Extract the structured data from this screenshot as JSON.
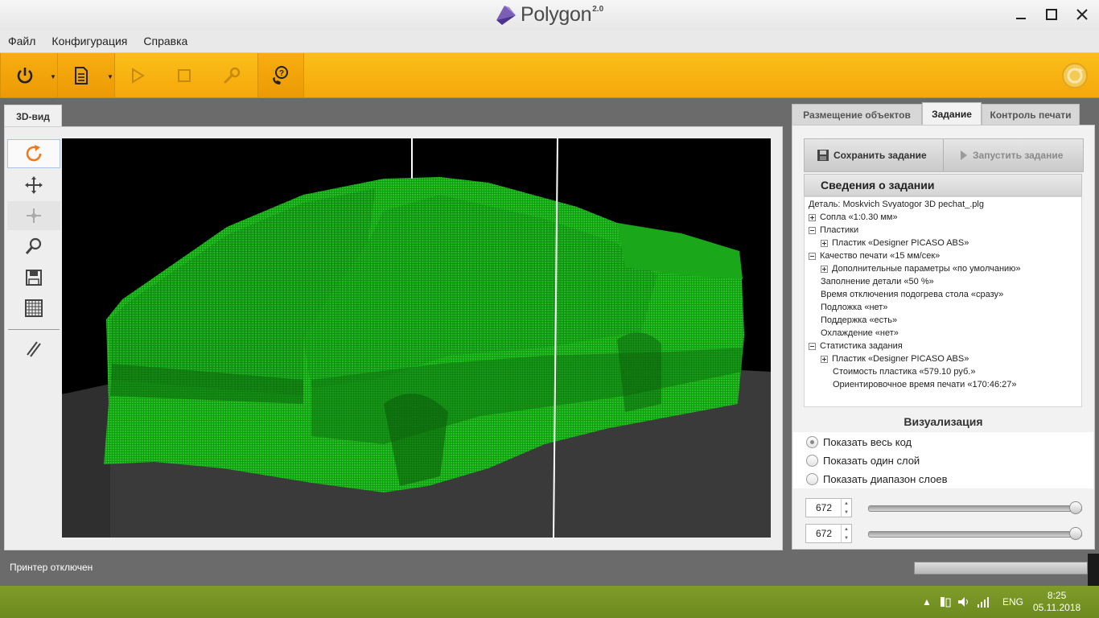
{
  "app": {
    "name": "Polygon",
    "version": "2.0"
  },
  "menu": [
    "Файл",
    "Конфигурация",
    "Справка"
  ],
  "left": {
    "tab_label": "3D-вид"
  },
  "right": {
    "tabs": [
      "Размещение объектов",
      "Задание",
      "Контроль печати"
    ],
    "active_tab": "Задание",
    "save_label": "Сохранить задание",
    "run_label": "Запустить задание",
    "info_title": "Сведения о задании",
    "tree": [
      "Деталь: Moskvich Svyatogor 3D pechat_.plg",
      "Сопла «1:0.30 мм»",
      "Пластики",
      "Пластик «Designer PICASO ABS»",
      "Качество печати «15 мм/сек»",
      "Дополнительные параметры «по умолчанию»",
      "Заполнение детали «50 %»",
      "Время отключения подогрева стола «сразу»",
      "Подложка «нет»",
      "Поддержка «есть»",
      "Охлаждение «нет»",
      "Статистика задания",
      "Пластик «Designer PICASO ABS»",
      "Стоимость пластика «579.10 руб.»",
      "Ориентировочное время печати «170:46:27»"
    ],
    "viz_title": "Визуализация",
    "viz_options": [
      "Показать весь код",
      "Показать один слой",
      "Показать диапазон слоев"
    ],
    "viz_selected": 0,
    "layer_from": "672",
    "layer_to": "672",
    "slider_from_value": 1.0,
    "slider_to_value": 1.0
  },
  "status": {
    "text": "Принтер отключен"
  },
  "taskbar": {
    "lang": "ENG",
    "time": "8:25",
    "date": "05.11.2018"
  },
  "colors": {
    "toolbar": "#f9b313",
    "model": "#16a516",
    "accent_blue": "#2e6db4"
  },
  "icons": [
    "power-icon",
    "document-icon",
    "play-icon",
    "stop-icon",
    "wrench-icon",
    "support-icon",
    "refresh-icon",
    "rotate-icon",
    "move-icon",
    "pan-icon",
    "zoom-icon",
    "save-view-icon",
    "grid-icon",
    "section-icon"
  ]
}
